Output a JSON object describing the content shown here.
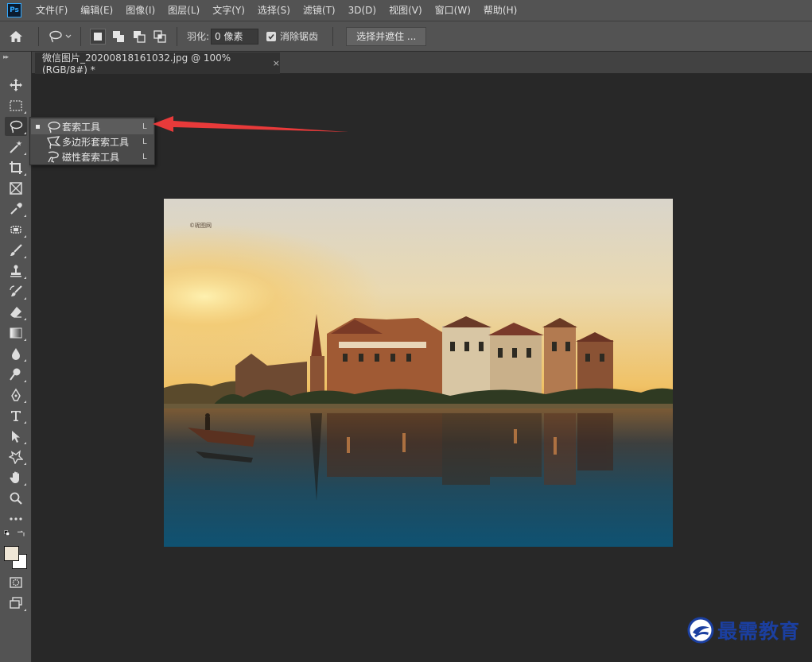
{
  "app": {
    "logo": "Ps"
  },
  "menu": [
    "文件(F)",
    "编辑(E)",
    "图像(I)",
    "图层(L)",
    "文字(Y)",
    "选择(S)",
    "滤镜(T)",
    "3D(D)",
    "视图(V)",
    "窗口(W)",
    "帮助(H)"
  ],
  "options": {
    "feather_label": "羽化:",
    "feather_value": "0 像素",
    "antialias_label": "消除锯齿",
    "select_mask_label": "选择并遮住 ..."
  },
  "document_tab": {
    "title": "微信图片_20200818161032.jpg @ 100%(RGB/8#) *",
    "close": "×"
  },
  "photo": {
    "watermark": "©昵图网"
  },
  "flyout": [
    {
      "label": "套索工具",
      "shortcut": "L",
      "selected": true
    },
    {
      "label": "多边形套索工具",
      "shortcut": "L",
      "selected": false
    },
    {
      "label": "磁性套索工具",
      "shortcut": "L",
      "selected": false
    }
  ],
  "brand": {
    "text": "最需教育"
  },
  "colors": {
    "foreground": "#efe6d6",
    "background": "#ffffff",
    "annotation_arrow": "#e83a3a"
  }
}
